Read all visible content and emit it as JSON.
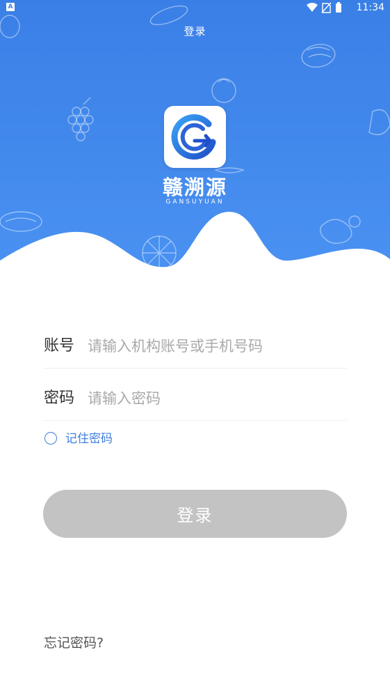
{
  "status_bar": {
    "notification_badge": "A",
    "time": "11:34",
    "icons": [
      "wifi-icon",
      "no-sim-icon",
      "battery-icon"
    ]
  },
  "header": {
    "title": "登录"
  },
  "brand": {
    "name": "赣溯源",
    "subtitle": "GANSUYUAN"
  },
  "form": {
    "account": {
      "label": "账号",
      "placeholder": "请输入机构账号或手机号码",
      "value": ""
    },
    "password": {
      "label": "密码",
      "placeholder": "请输入密码",
      "value": ""
    },
    "remember": {
      "label": "记住密码",
      "checked": false
    },
    "submit_label": "登录"
  },
  "footer": {
    "forgot_label": "忘记密码?"
  },
  "colors": {
    "header_blue": "#3d83e8",
    "accent_blue": "#3d7fdf",
    "button_disabled": "#c3c3c3"
  }
}
